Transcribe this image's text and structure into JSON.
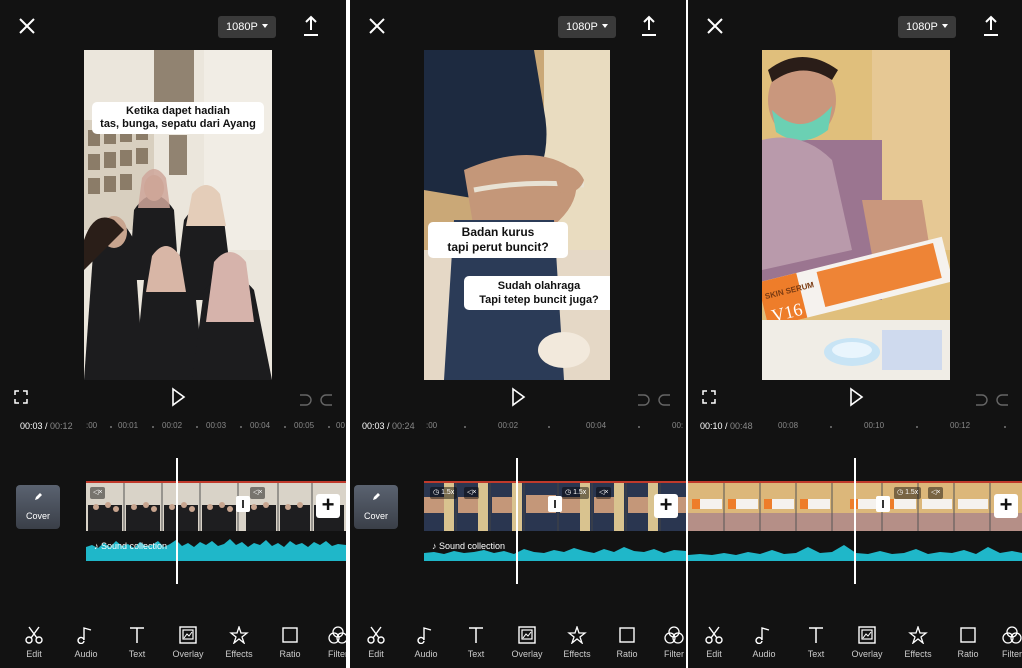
{
  "screens": [
    {
      "resolution": "1080P",
      "caption": [
        "Ketika dapet hadiah",
        "tas, bunga, sepatu dari Ayang"
      ],
      "time_current": "00:03",
      "time_total": "00:12",
      "ruler_ticks": [
        ":00",
        "00:01",
        "00:02",
        "00:03",
        "00:04",
        "00:05",
        "00"
      ],
      "cover_label": "Cover",
      "audio_label": "Sound collection"
    },
    {
      "resolution": "1080P",
      "captions": [
        [
          "Badan kurus",
          "tapi perut buncit?"
        ],
        [
          "Sudah olahraga",
          "Tapi tetep buncit juga?"
        ]
      ],
      "time_current": "00:03",
      "time_total": "00:24",
      "ruler_ticks": [
        ":00",
        "00:02",
        "00:04",
        "00:"
      ],
      "cover_label": "Cover",
      "audio_label": "Sound collection",
      "clip_speed_badges": [
        "1.5x",
        "1.5x"
      ]
    },
    {
      "resolution": "1080P",
      "product_text": [
        "SKIN SERUM",
        "V16"
      ],
      "time_current": "00:10",
      "time_total": "00:48",
      "ruler_ticks": [
        "00:08",
        "00:10",
        "00:12"
      ],
      "clip_speed_badges": [
        "1.5x"
      ]
    }
  ],
  "toolbar": {
    "items": [
      {
        "label": "Edit",
        "icon": "scissors-icon"
      },
      {
        "label": "Audio",
        "icon": "music-note-icon"
      },
      {
        "label": "Text",
        "icon": "text-icon"
      },
      {
        "label": "Overlay",
        "icon": "overlay-icon"
      },
      {
        "label": "Effects",
        "icon": "effects-star-icon"
      },
      {
        "label": "Ratio",
        "icon": "ratio-icon"
      },
      {
        "label": "Filter",
        "icon": "filter-icon"
      }
    ]
  },
  "colors": {
    "background": "#121212",
    "audio_wave": "#1fb7c9",
    "track_border": "#c0392b"
  }
}
